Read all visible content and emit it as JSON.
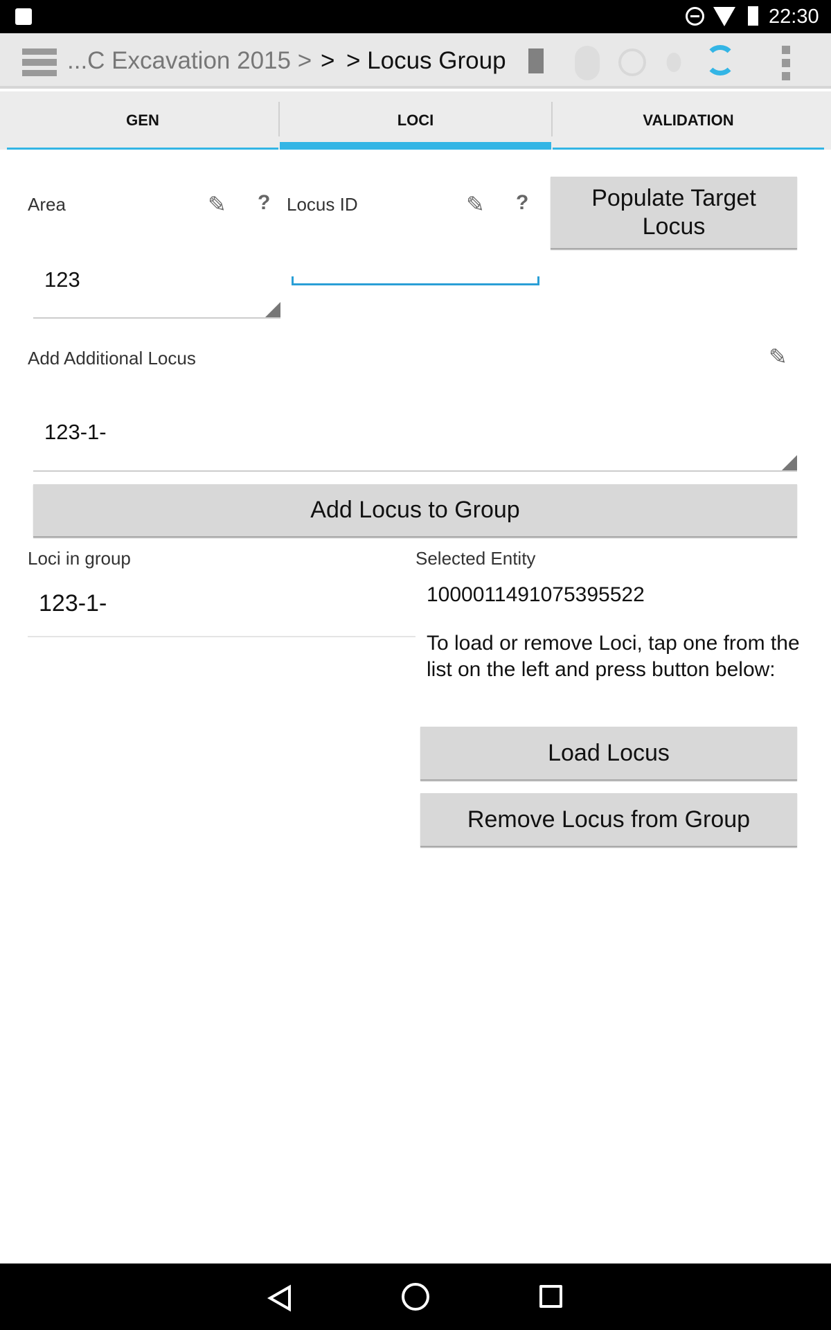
{
  "status_bar": {
    "time": "22:30",
    "icons": [
      "image-notification-icon",
      "do-not-disturb-icon",
      "wifi-icon",
      "battery-icon"
    ]
  },
  "toolbar": {
    "breadcrumb_parent": "...C Excavation 2015 >",
    "breadcrumb_sep": ">",
    "title": "> Locus Group",
    "icons": [
      "menu-icon",
      "sync-list-icon",
      "bluetooth-icon",
      "gps-icon",
      "footsteps-icon",
      "sync-icon",
      "overflow-menu-icon"
    ],
    "accent": "#33b5e5"
  },
  "tabs": [
    {
      "label": "GEN"
    },
    {
      "label": "LOCI",
      "active": true
    },
    {
      "label": "VALIDATION"
    }
  ],
  "form": {
    "area_label": "Area",
    "area_value": "123",
    "locus_id_label": "Locus ID",
    "locus_id_value": "",
    "help": "?",
    "populate_button": "Populate Target Locus",
    "additional_label": "Add Additional Locus",
    "additional_value": "123-1-",
    "add_button": "Add Locus to Group",
    "loci_label": "Loci in group",
    "loci_items": [
      "123-1-"
    ],
    "selected_label": "Selected Entity",
    "selected_value": "1000011491075395522",
    "instructions": "To load or remove Loci, tap one from the list on the left and press button below:",
    "load_button": "Load Locus",
    "remove_button": "Remove Locus from Group"
  }
}
